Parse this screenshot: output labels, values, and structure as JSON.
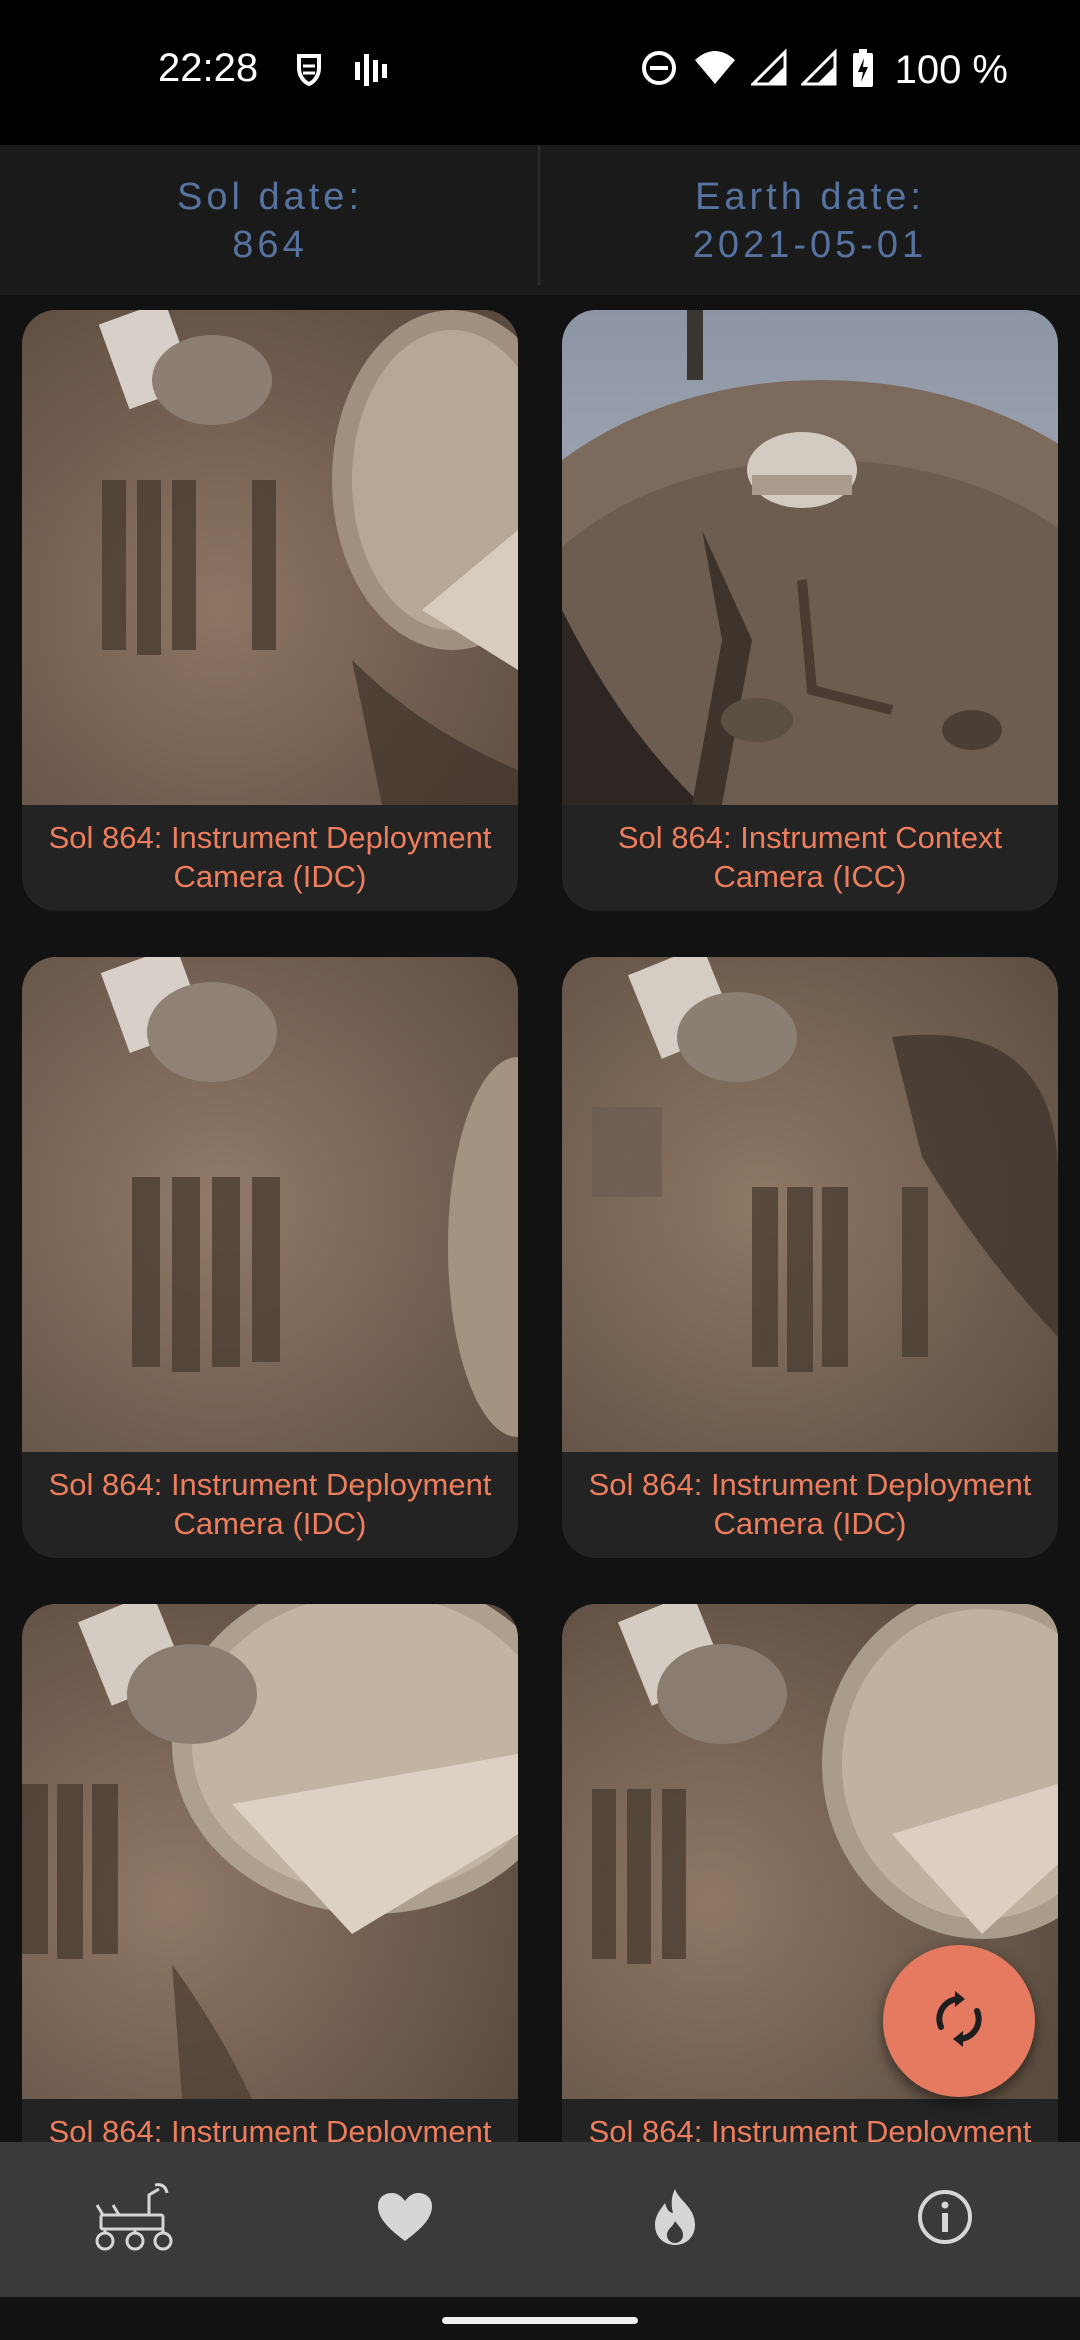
{
  "status_bar": {
    "time": "22:28",
    "battery": "100 %",
    "icons": [
      "notification-icon",
      "signal-app-icon",
      "do-not-disturb-icon",
      "wifi-icon",
      "cell-signal-icon",
      "cell-signal-icon",
      "battery-charging-icon"
    ]
  },
  "header": {
    "sol_label": "Sol date:",
    "sol_value": "864",
    "earth_label": "Earth date:",
    "earth_value": "2021-05-01"
  },
  "photos": [
    {
      "caption": "Sol 864: Instrument Deployment Camera (IDC)"
    },
    {
      "caption": "Sol 864: Instrument Context Camera (ICC)"
    },
    {
      "caption": "Sol 864: Instrument Deployment Camera (IDC)"
    },
    {
      "caption": "Sol 864: Instrument Deployment Camera (IDC)"
    },
    {
      "caption": "Sol 864: Instrument Deployment"
    },
    {
      "caption": "Sol 864: Instrument Deployment"
    }
  ],
  "fab": {
    "icon": "refresh-icon"
  },
  "bottom_nav": [
    {
      "icon": "rover-icon"
    },
    {
      "icon": "heart-icon"
    },
    {
      "icon": "fire-icon"
    },
    {
      "icon": "info-icon"
    }
  ],
  "colors": {
    "accent": "#ec7d5d",
    "header_text": "#56729f",
    "fab": "#e57a60",
    "nav_background": "#3a3a3a"
  }
}
